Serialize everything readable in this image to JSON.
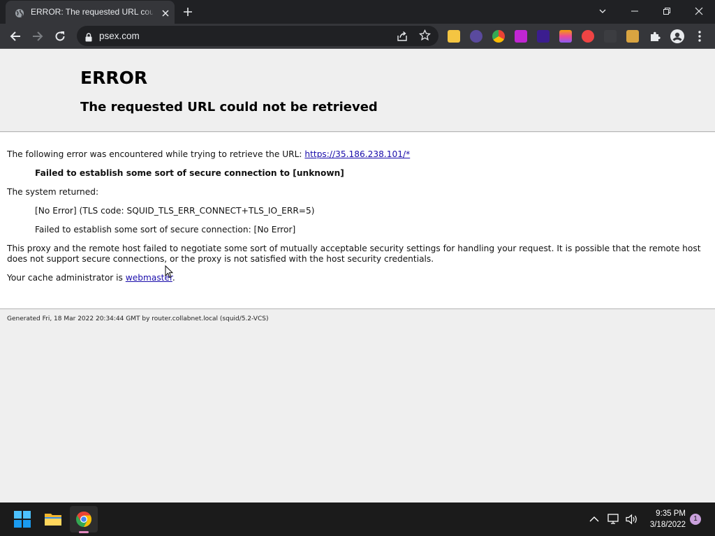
{
  "browser": {
    "tab_title": "ERROR: The requested URL could not be retrieved",
    "url": "psex.com"
  },
  "page": {
    "heading": "ERROR",
    "subheading": "The requested URL could not be retrieved",
    "intro_text": "The following error was encountered while trying to retrieve the URL: ",
    "error_url": "https://35.186.238.101/*",
    "error_summary": "Failed to establish some sort of secure connection to [unknown]",
    "system_returned_label": "The system returned:",
    "tls_code": "[No Error] (TLS code: SQUID_TLS_ERR_CONNECT+TLS_IO_ERR=5)",
    "system_detail": "Failed to establish some sort of secure connection: [No Error]",
    "explanation_line1": "This proxy and the remote host failed to negotiate some sort of mutually acceptable security settings for handling your request. It is possible that the remote host",
    "explanation_line2": "does not support secure connections, or the proxy is not satisfied with the host security credentials.",
    "admin_text": "Your cache administrator is ",
    "admin_link": "webmaster",
    "admin_suffix": ".",
    "footer": "Generated Fri, 18 Mar 2022 20:34:44 GMT by router.collabnet.local (squid/5.2-VCS)"
  },
  "taskbar": {
    "time": "9:35 PM",
    "date": "3/18/2022",
    "notification_count": "1"
  },
  "colors": {
    "link": "#1a0dab",
    "chrome_dark": "#202124",
    "toolbar": "#35363a"
  }
}
